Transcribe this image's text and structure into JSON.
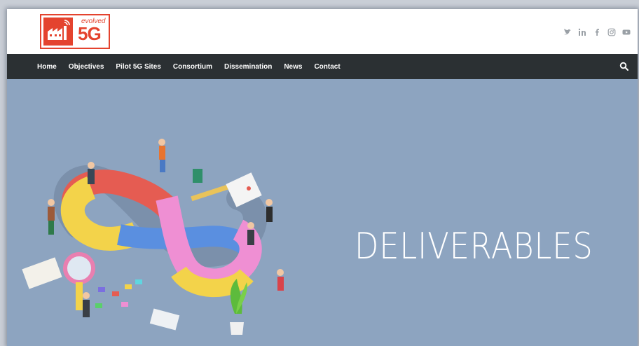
{
  "brand": {
    "logo_word": "evolved",
    "logo_mark": "5G",
    "color": "#e4432e"
  },
  "social": [
    "twitter-icon",
    "linkedin-icon",
    "facebook-icon",
    "instagram-icon",
    "youtube-icon"
  ],
  "nav": {
    "items": [
      "Home",
      "Objectives",
      "Pilot 5G Sites",
      "Consortium",
      "Dissemination",
      "News",
      "Contact"
    ],
    "search_icon": "search-icon",
    "background": "#2b3033"
  },
  "hero": {
    "title": "DELIVERABLES",
    "background": "#8da4c0"
  }
}
